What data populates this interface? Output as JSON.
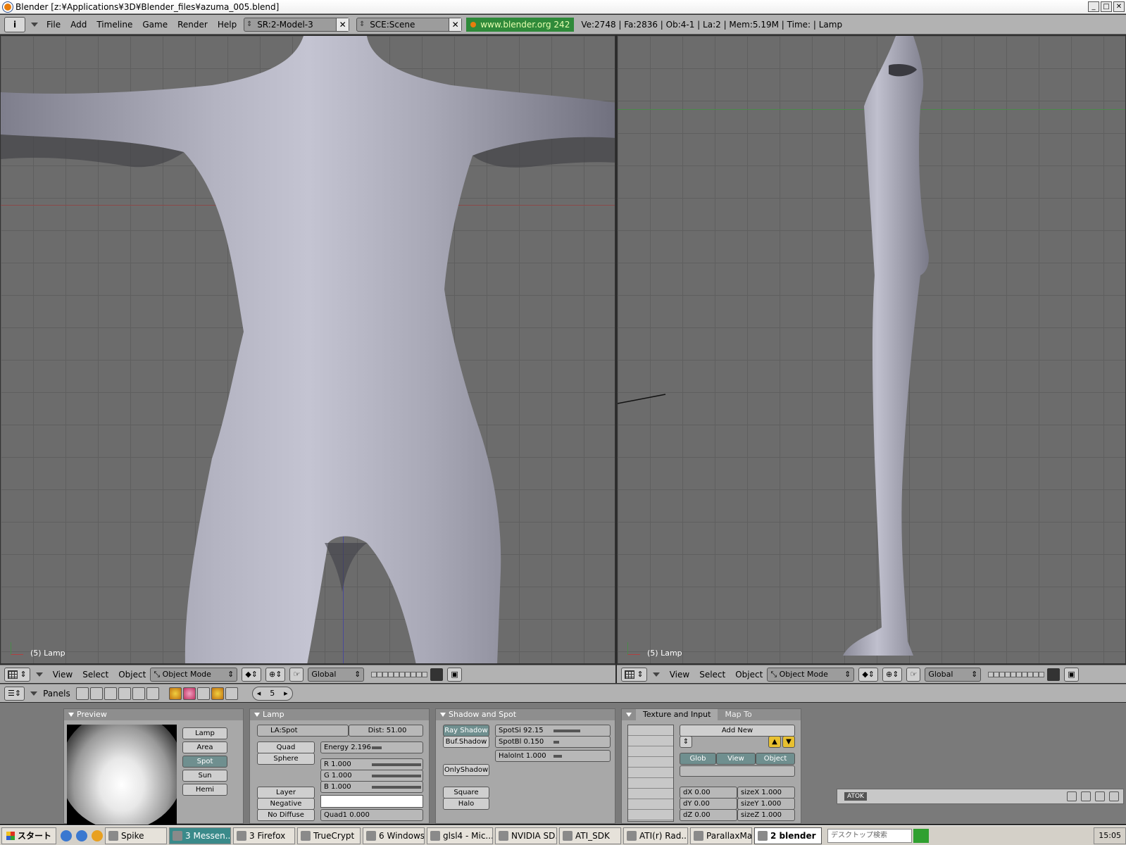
{
  "window": {
    "title": "Blender [z:¥Applications¥3D¥Blender_files¥azuma_005.blend]"
  },
  "header": {
    "menus": [
      "File",
      "Add",
      "Timeline",
      "Game",
      "Render",
      "Help"
    ],
    "screen": "SR:2-Model-3",
    "scene": "SCE:Scene",
    "url": "www.blender.org 242",
    "stats": "Ve:2748 | Fa:2836 | Ob:4-1 | La:2  | Mem:5.19M  | Time: | Lamp"
  },
  "viewports": [
    {
      "label": "(5) Lamp",
      "menus": [
        "View",
        "Select",
        "Object"
      ],
      "mode": "Object Mode",
      "orientation": "Global"
    },
    {
      "label": "(5) Lamp",
      "menus": [
        "View",
        "Select",
        "Object"
      ],
      "mode": "Object Mode",
      "orientation": "Global"
    }
  ],
  "buttons_header": {
    "panels_label": "Panels",
    "frame": "5"
  },
  "preview": {
    "title": "Preview",
    "types": [
      "Lamp",
      "Area",
      "Spot",
      "Sun",
      "Hemi"
    ],
    "selected": "Spot"
  },
  "lamp": {
    "title": "Lamp",
    "name": "LA:Spot",
    "dist": "Dist: 51.00",
    "quad": "Quad",
    "sphere": "Sphere",
    "energy": "Energy 2.196",
    "energy_fill": 0.2,
    "r": "R 1.000",
    "g": "G 1.000",
    "b": "B 1.000",
    "layer": "Layer",
    "negative": "Negative",
    "no_diffuse": "No Diffuse",
    "quad1": "Quad1 0.000"
  },
  "shadow": {
    "title": "Shadow and Spot",
    "ray_shadow": "Ray Shadow",
    "buf_shadow": "Buf.Shadow",
    "only_shadow": "OnlyShadow",
    "square": "Square",
    "halo": "Halo",
    "spot_si": "SpotSi 92.15",
    "spot_bl": "SpotBl 0.150",
    "halo_int": "HaloInt 1.000"
  },
  "texture": {
    "tab_active": "Texture and Input",
    "tab_inactive": "Map To",
    "add_new": "Add New",
    "coords": [
      "Glob",
      "View",
      "Object"
    ],
    "coord_selected": "View",
    "dx": "dX 0.00",
    "dy": "dY 0.00",
    "dz": "dZ 0.00",
    "sx": "sizeX 1.000",
    "sy": "sizeY 1.000",
    "sz": "sizeZ 1.000"
  },
  "atok": {
    "label": "ATOK"
  },
  "taskbar": {
    "start": "スタート",
    "tasks": [
      "Spike",
      "3 Messen...",
      "3 Firefox",
      "TrueCrypt",
      "6 Windows...",
      "glsl4 - Mic...",
      "NVIDIA SD...",
      "ATI_SDK",
      "ATI(r) Rad...",
      "ParallaxMa...",
      "2 blender"
    ],
    "search_placeholder": "デスクトップ検索",
    "clock": "15:05"
  }
}
